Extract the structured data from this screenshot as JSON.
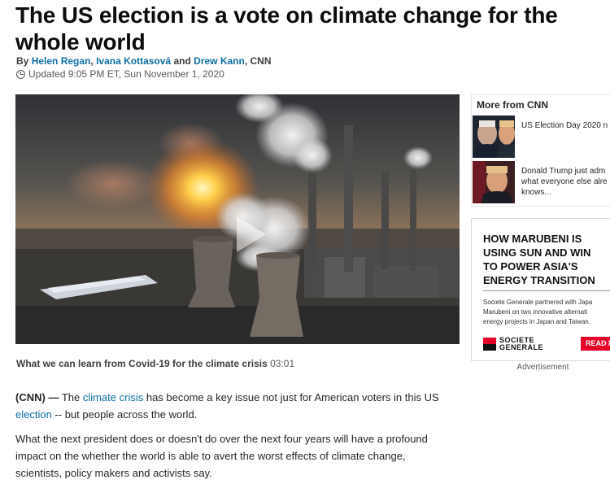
{
  "article": {
    "headline": "The US election is a vote on climate change for the whole world",
    "byline": {
      "prefix": "By",
      "author1": "Helen Regan",
      "sep1": ",",
      "author2": "Ivana Kottasová",
      "and": "and",
      "author3": "Drew Kann",
      "suffix": ", CNN"
    },
    "updated": "Updated 9:05 PM ET, Sun November 1, 2020"
  },
  "video": {
    "caption_title": "What we can learn from Covid-19 for the climate crisis",
    "duration": "03:01"
  },
  "body": {
    "p1_tag": "(CNN) —",
    "p1_a": " The ",
    "p1_link1": "climate crisis",
    "p1_b": " has become a key issue not just for American voters in this US ",
    "p1_link2": "election",
    "p1_c": " -- but people across the world.",
    "p2": "What the next president does or doesn't do over the next four years will have a profound impact on the whether the world is able to avert the worst effects of climate change, scientists, policy makers and activists say."
  },
  "sidebar": {
    "more_title": "More from CNN",
    "items": [
      {
        "text": "US Election Day 2020 n"
      },
      {
        "text": "Donald Trump just adm\nwhat everyone else alre\nknows..."
      }
    ]
  },
  "ad": {
    "headline": "HOW MARUBENI IS\nUSING SUN AND WIN\nTO POWER ASIA'S\nENERGY TRANSITION",
    "body": "Societe Generale partnered with Japa\nMarubeni on two innovative alternati\nenergy projects in Japan and Taiwan.",
    "brand_line1": "SOCIETE",
    "brand_line2": "GENERALE",
    "cta": "READ M",
    "label": "Advertisement"
  },
  "colors": {
    "link": "#0c6ea6",
    "brand_red": "#e60028"
  }
}
